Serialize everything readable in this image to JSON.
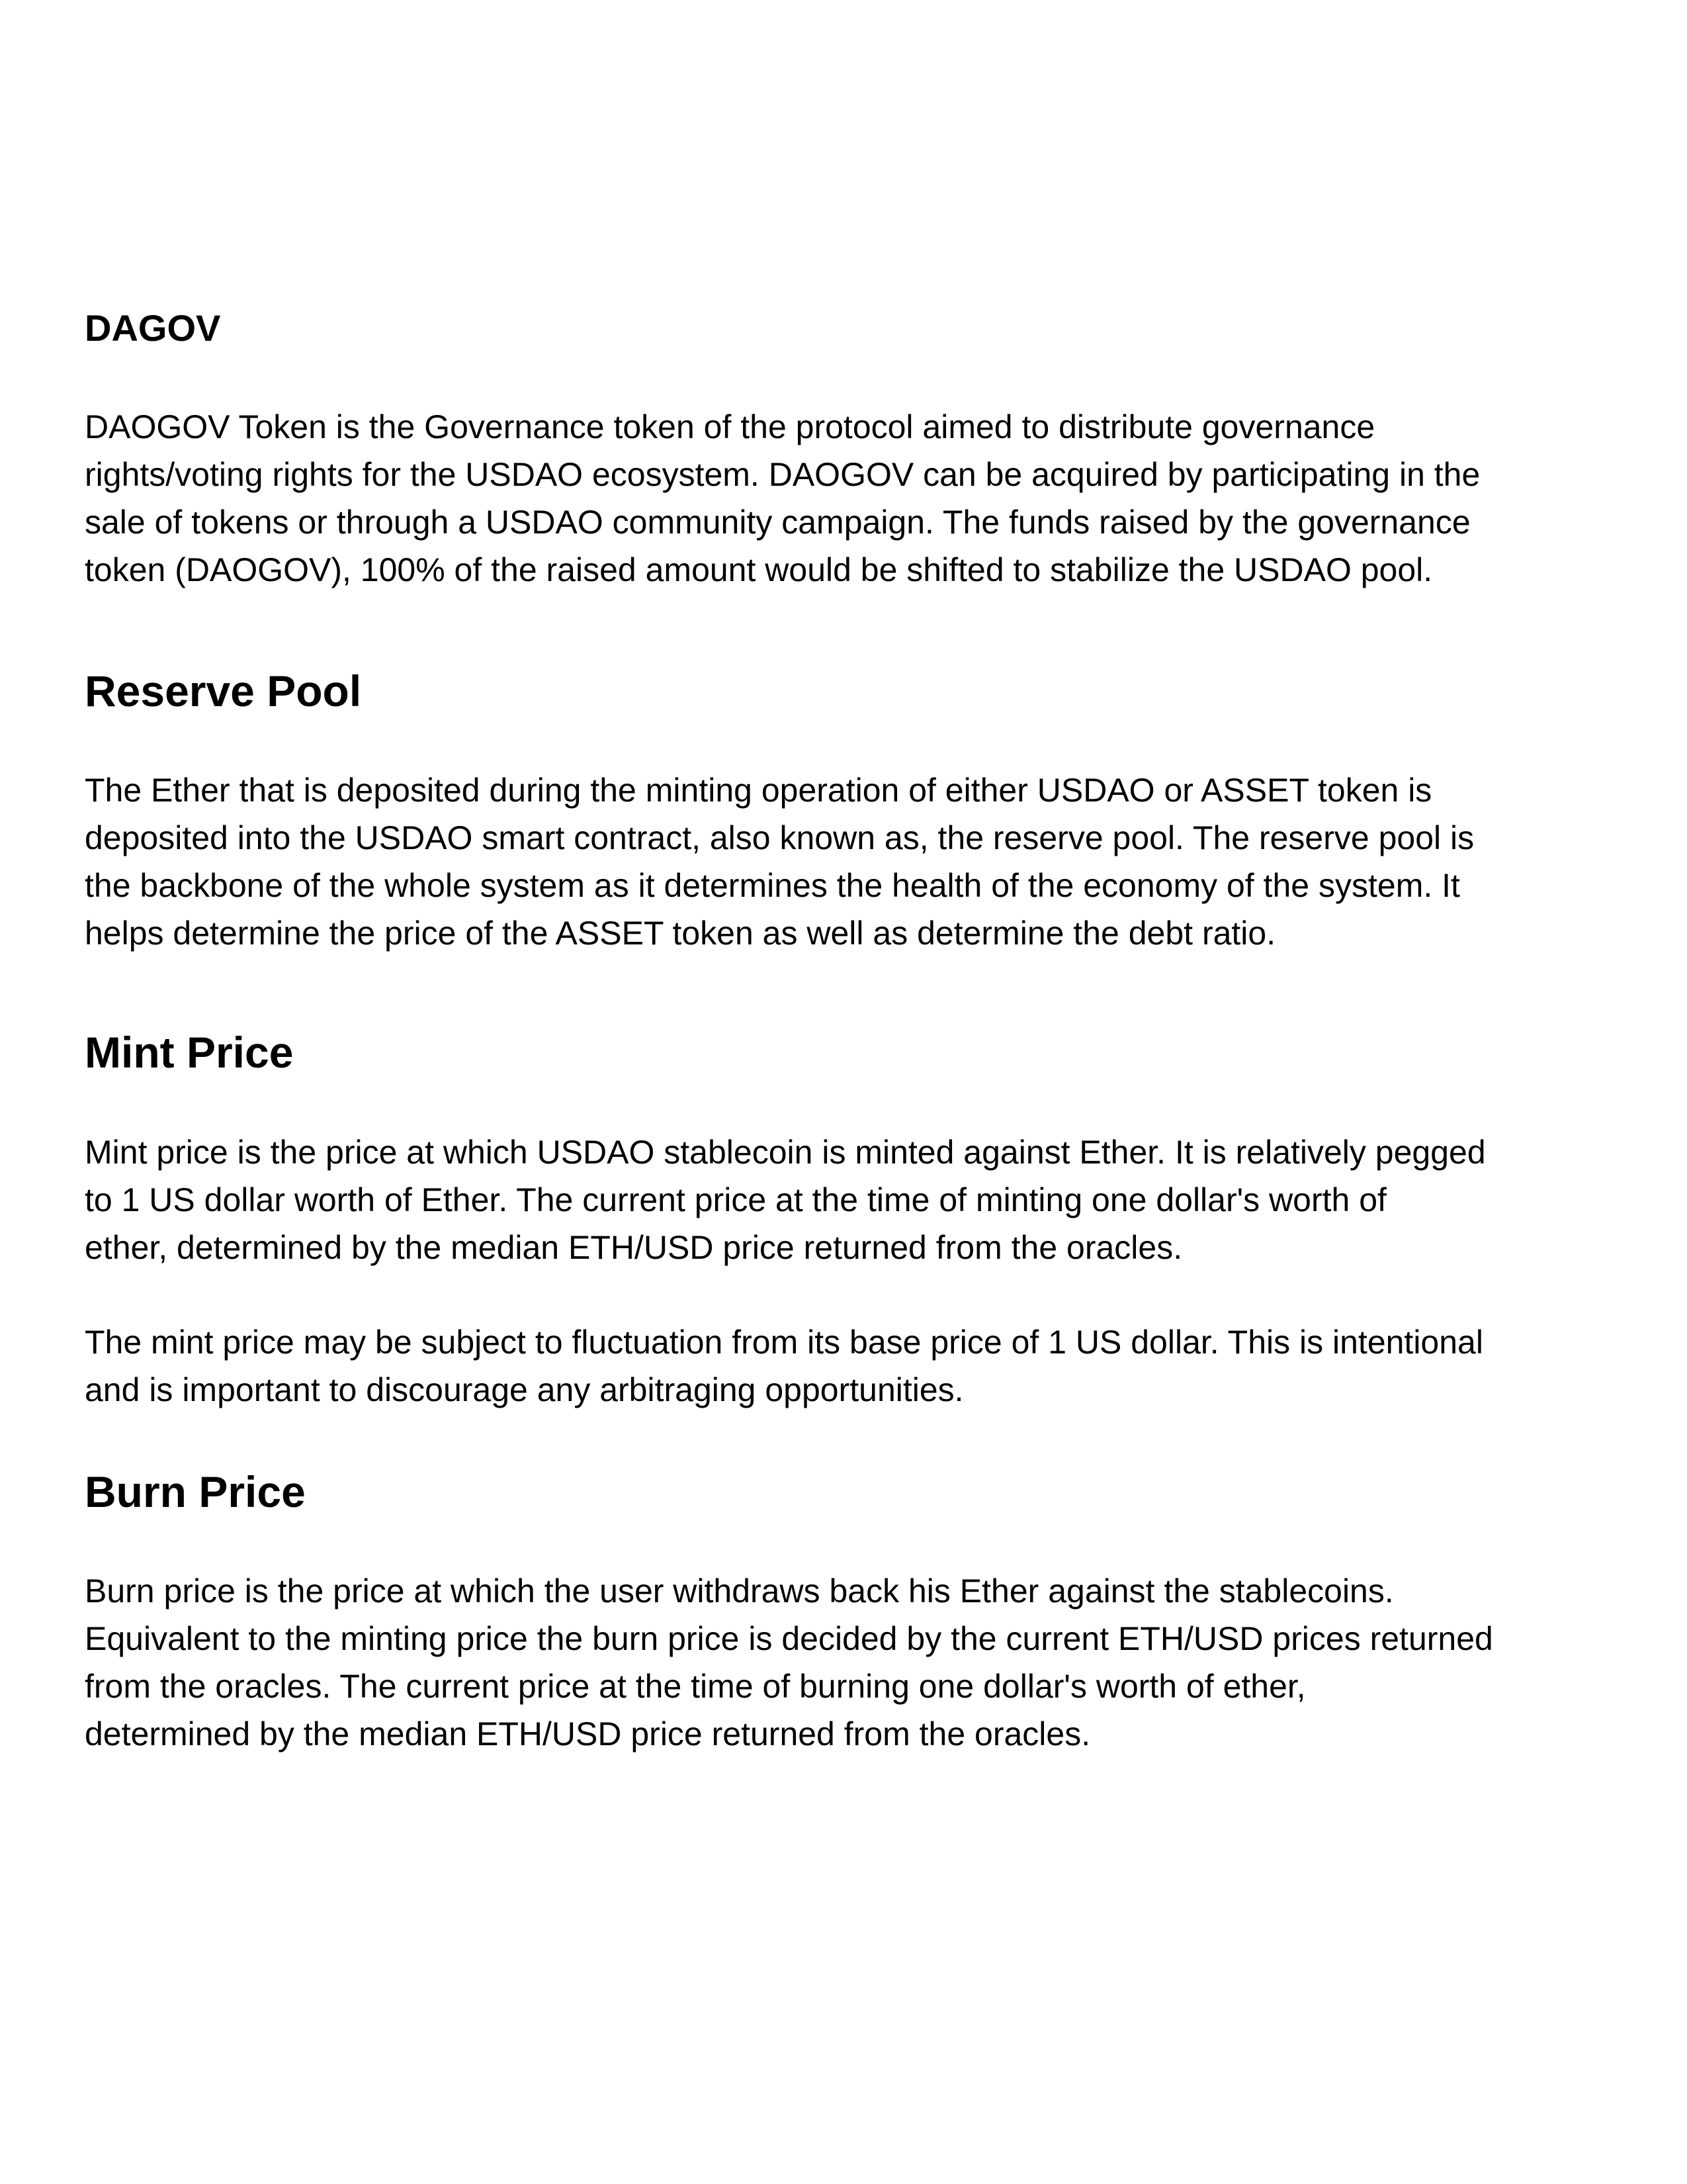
{
  "sections": [
    {
      "heading": "DAGOV",
      "paragraphs": [
        [
          "DAOGOV Token is the Governance token of the protocol aimed to distribute governance",
          "rights/voting rights for the USDAO ecosystem. DAOGOV can be acquired by participating in the",
          "sale of tokens or through a USDAO community campaign. The funds raised by the governance",
          "token (DAOGOV), 100% of the raised amount would be shifted to stabilize the USDAO pool."
        ]
      ]
    },
    {
      "heading": "Reserve Pool",
      "paragraphs": [
        [
          "The Ether that is deposited during the minting operation of either USDAO or ASSET token is",
          "deposited into the USDAO smart contract, also known as, the reserve pool. The reserve pool is",
          "the backbone of the whole system as it determines the health of the economy of the system. It",
          "helps determine the price of the ASSET token as well as determine the debt ratio."
        ]
      ]
    },
    {
      "heading": "Mint Price",
      "paragraphs": [
        [
          "Mint price is the price at which USDAO stablecoin is minted against Ether. It is relatively pegged",
          "to 1 US dollar worth of Ether.  The current price at the time of minting one dollar's worth of",
          "ether,  determined by the median ETH/USD price returned from the oracles."
        ],
        [
          "The mint price may be subject to fluctuation from its base price of 1 US dollar. This is intentional",
          "and is important to discourage any arbitraging opportunities."
        ]
      ]
    },
    {
      "heading": "Burn Price",
      "paragraphs": [
        [
          "Burn price is the price at which the user withdraws back his Ether against the stablecoins.",
          "Equivalent to the minting price the burn price is decided by the current ETH/USD prices returned",
          "from the oracles. The current price at the time of burning one dollar's worth of ether,",
          "determined by the median ETH/USD price returned from the oracles."
        ]
      ]
    }
  ]
}
